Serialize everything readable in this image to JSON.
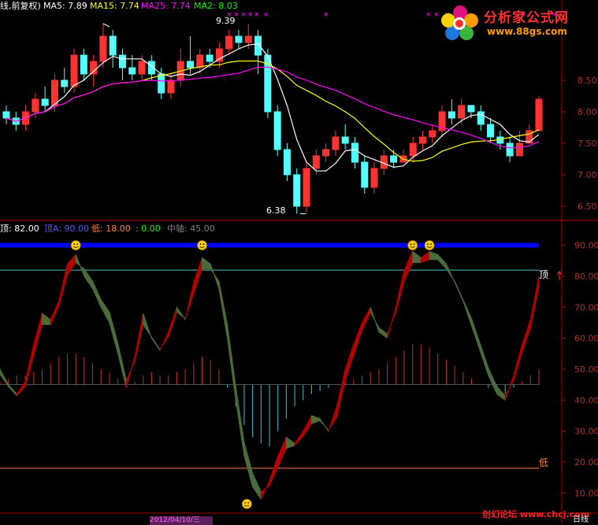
{
  "header": {
    "title": "线,前复权)",
    "ma5_label": "MA5: 7.89",
    "ma15_label": "MA15: 7.74",
    "ma25_label": "MA25: 7.74",
    "ma2_label": "MA2: 8.03"
  },
  "colors": {
    "background": "#000000",
    "up": "#ff3232",
    "down": "#54ffff",
    "ma5": "#ffffff",
    "ma15": "#ffff00",
    "ma25": "#ff00ff",
    "ma2": "#00ff00",
    "band_up": "#b00000",
    "band_down": "#4a6b3a",
    "top_line": "#0000ff",
    "axis": "#b00000",
    "tick_text": "#b03030"
  },
  "annotations": {
    "high_label": "9.39",
    "low_label": "6.38"
  },
  "indicator": {
    "top_label": "顶: 82.00",
    "topa_label": "顶A: 90.00",
    "low_label": "低: 18.00",
    "zero_label": ": 0.00",
    "mid_label": "中轴: 45.00",
    "top_side_label": "顶",
    "low_side_label": "低"
  },
  "logo": {
    "title": "分析家公式网",
    "url": "www.88gs.com"
  },
  "watermark": "创幻论坛 www.chcj.com",
  "date_label": "2012/04/10/三",
  "period_label": "日线",
  "chart_data": [
    {
      "type": "candlestick",
      "title": "",
      "y_ticks": [
        6.5,
        7.0,
        7.5,
        8.0,
        8.5
      ],
      "ylim": [
        6.3,
        9.6
      ],
      "series": [
        {
          "name": "MA5",
          "values": []
        },
        {
          "name": "MA15",
          "values": []
        },
        {
          "name": "MA25",
          "values": []
        }
      ],
      "candles": [
        [
          8.0,
          7.9,
          8.1,
          7.8
        ],
        [
          7.9,
          7.8,
          8.0,
          7.7
        ],
        [
          7.8,
          8.0,
          8.1,
          7.7
        ],
        [
          8.0,
          8.2,
          8.3,
          7.9
        ],
        [
          8.2,
          8.1,
          8.4,
          8.0
        ],
        [
          8.1,
          8.5,
          8.6,
          8.0
        ],
        [
          8.5,
          8.4,
          8.7,
          8.3
        ],
        [
          8.4,
          8.9,
          9.0,
          8.3
        ],
        [
          8.9,
          8.6,
          9.0,
          8.5
        ],
        [
          8.6,
          8.8,
          8.9,
          8.4
        ],
        [
          8.8,
          9.2,
          9.4,
          8.7
        ],
        [
          9.2,
          8.9,
          9.3,
          8.7
        ],
        [
          8.9,
          8.7,
          9.0,
          8.5
        ],
        [
          8.7,
          8.6,
          8.9,
          8.5
        ],
        [
          8.6,
          8.8,
          8.9,
          8.5
        ],
        [
          8.8,
          8.6,
          8.9,
          8.5
        ],
        [
          8.6,
          8.3,
          8.7,
          8.2
        ],
        [
          8.3,
          8.5,
          8.6,
          8.2
        ],
        [
          8.5,
          8.8,
          9.0,
          8.4
        ],
        [
          8.8,
          8.7,
          9.2,
          8.6
        ],
        [
          8.7,
          8.9,
          9.0,
          8.6
        ],
        [
          8.9,
          8.8,
          9.0,
          8.7
        ],
        [
          8.8,
          9.0,
          9.1,
          8.7
        ],
        [
          9.0,
          9.2,
          9.3,
          8.9
        ],
        [
          9.2,
          9.1,
          9.3,
          9.0
        ],
        [
          9.1,
          9.2,
          9.39,
          9.0
        ],
        [
          9.2,
          8.9,
          9.3,
          8.6
        ],
        [
          8.9,
          8.0,
          9.0,
          7.9
        ],
        [
          8.0,
          7.4,
          8.1,
          7.3
        ],
        [
          7.4,
          7.0,
          7.5,
          6.9
        ],
        [
          7.0,
          6.5,
          7.1,
          6.38
        ],
        [
          6.5,
          7.1,
          7.2,
          6.4
        ],
        [
          7.1,
          7.3,
          7.4,
          7.0
        ],
        [
          7.3,
          7.4,
          7.5,
          7.2
        ],
        [
          7.4,
          7.6,
          7.7,
          7.3
        ],
        [
          7.6,
          7.5,
          7.8,
          7.4
        ],
        [
          7.5,
          7.2,
          7.6,
          7.1
        ],
        [
          7.2,
          6.8,
          7.3,
          6.7
        ],
        [
          6.8,
          7.1,
          7.2,
          6.7
        ],
        [
          7.1,
          7.3,
          7.4,
          7.0
        ],
        [
          7.3,
          7.2,
          7.4,
          7.1
        ],
        [
          7.2,
          7.3,
          7.4,
          7.2
        ],
        [
          7.3,
          7.5,
          7.6,
          7.2
        ],
        [
          7.5,
          7.6,
          7.7,
          7.4
        ],
        [
          7.6,
          7.7,
          7.8,
          7.5
        ],
        [
          7.7,
          8.0,
          8.1,
          7.6
        ],
        [
          8.0,
          7.9,
          8.2,
          7.8
        ],
        [
          7.9,
          8.1,
          8.2,
          7.8
        ],
        [
          8.1,
          8.0,
          8.1,
          7.9
        ],
        [
          8.0,
          7.8,
          8.1,
          7.7
        ],
        [
          7.8,
          7.6,
          7.9,
          7.5
        ],
        [
          7.6,
          7.5,
          7.7,
          7.4
        ],
        [
          7.5,
          7.3,
          7.6,
          7.2
        ],
        [
          7.3,
          7.5,
          7.7,
          7.3
        ],
        [
          7.5,
          7.7,
          7.8,
          7.5
        ],
        [
          7.7,
          8.2,
          8.25,
          7.7
        ]
      ]
    },
    {
      "type": "area",
      "title": "",
      "y_ticks": [
        10.0,
        20.0,
        30.0,
        40.0,
        50.0,
        60.0,
        70.0,
        80.0,
        90.0
      ],
      "ylim": [
        4,
        96
      ],
      "reference_lines": {
        "top": 82,
        "topA": 90,
        "low": 18,
        "mid": 45
      },
      "fast": [
        50,
        45,
        42,
        46,
        58,
        68,
        66,
        72,
        84,
        87,
        80,
        76,
        70,
        65,
        55,
        44,
        54,
        68,
        60,
        56,
        62,
        70,
        66,
        78,
        86,
        84,
        76,
        60,
        40,
        22,
        12,
        8,
        14,
        22,
        28,
        26,
        30,
        35,
        34,
        30,
        38,
        50,
        58,
        65,
        70,
        62,
        60,
        70,
        82,
        88,
        86,
        88,
        87,
        84,
        78,
        72,
        64,
        56,
        48,
        42,
        40,
        48,
        58,
        66,
        80
      ],
      "slow": [
        48,
        44,
        41,
        44,
        54,
        64,
        64,
        70,
        80,
        84,
        82,
        78,
        72,
        68,
        58,
        46,
        52,
        64,
        60,
        56,
        60,
        68,
        66,
        74,
        82,
        82,
        78,
        64,
        44,
        26,
        16,
        10,
        12,
        18,
        24,
        25,
        28,
        32,
        33,
        30,
        34,
        46,
        54,
        62,
        68,
        63,
        61,
        68,
        78,
        84,
        84,
        85,
        85,
        82,
        78,
        72,
        66,
        58,
        50,
        44,
        41,
        46,
        55,
        63,
        76
      ],
      "histogram": [
        46,
        47,
        48,
        48,
        49,
        50,
        52,
        54,
        55,
        55,
        54,
        52,
        50,
        49,
        47,
        45,
        46,
        48,
        49,
        48,
        48,
        49,
        50,
        52,
        54,
        53,
        50,
        44,
        38,
        32,
        28,
        26,
        25,
        30,
        34,
        38,
        40,
        42,
        43,
        44,
        45,
        46,
        47,
        48,
        49,
        50,
        52,
        54,
        56,
        58,
        58,
        57,
        55,
        53,
        51,
        49,
        47,
        45,
        44,
        43,
        42,
        44,
        46,
        48,
        50
      ]
    }
  ]
}
